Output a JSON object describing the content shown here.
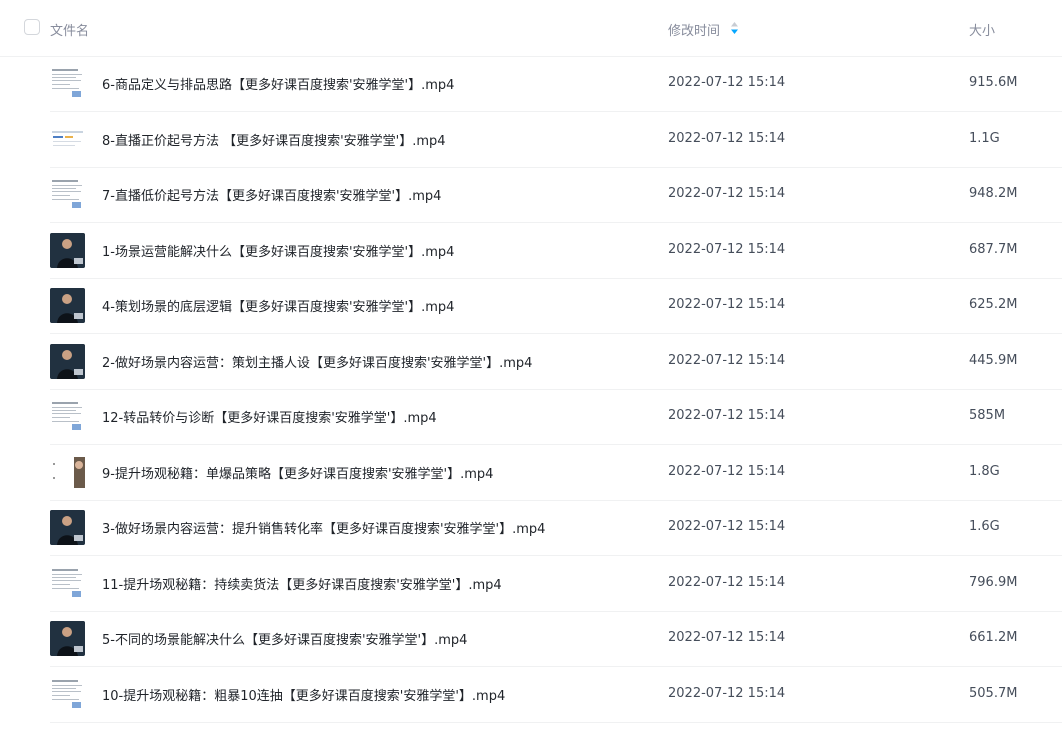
{
  "header": {
    "name_label": "文件名",
    "time_label": "修改时间",
    "size_label": "大小"
  },
  "files": [
    {
      "name": "6-商品定义与排品思路【更多好课百度搜索'安雅学堂'】.mp4",
      "time": "2022-07-12 15:14",
      "size": "915.6M",
      "thumb": "document"
    },
    {
      "name": "8-直播正价起号方法 【更多好课百度搜索'安雅学堂'】.mp4",
      "time": "2022-07-12 15:14",
      "size": "1.1G",
      "thumb": "slide"
    },
    {
      "name": "7-直播低价起号方法【更多好课百度搜索'安雅学堂'】.mp4",
      "time": "2022-07-12 15:14",
      "size": "948.2M",
      "thumb": "document"
    },
    {
      "name": "1-场景运营能解决什么【更多好课百度搜索'安雅学堂'】.mp4",
      "time": "2022-07-12 15:14",
      "size": "687.7M",
      "thumb": "presenter"
    },
    {
      "name": "4-策划场景的底层逻辑【更多好课百度搜索'安雅学堂'】.mp4",
      "time": "2022-07-12 15:14",
      "size": "625.2M",
      "thumb": "presenter"
    },
    {
      "name": "2-做好场景内容运营：策划主播人设【更多好课百度搜索'安雅学堂'】.mp4",
      "time": "2022-07-12 15:14",
      "size": "445.9M",
      "thumb": "presenter"
    },
    {
      "name": "12-转品转价与诊断【更多好课百度搜索'安雅学堂'】.mp4",
      "time": "2022-07-12 15:14",
      "size": "585M",
      "thumb": "document"
    },
    {
      "name": "9-提升场观秘籍：单爆品策略【更多好课百度搜索'安雅学堂'】.mp4",
      "time": "2022-07-12 15:14",
      "size": "1.8G",
      "thumb": "photo"
    },
    {
      "name": "3-做好场景内容运营：提升销售转化率【更多好课百度搜索'安雅学堂'】.mp4",
      "time": "2022-07-12 15:14",
      "size": "1.6G",
      "thumb": "presenter"
    },
    {
      "name": "11-提升场观秘籍：持续卖货法【更多好课百度搜索'安雅学堂'】.mp4",
      "time": "2022-07-12 15:14",
      "size": "796.9M",
      "thumb": "document"
    },
    {
      "name": "5-不同的场景能解决什么【更多好课百度搜索'安雅学堂'】.mp4",
      "time": "2022-07-12 15:14",
      "size": "661.2M",
      "thumb": "presenter"
    },
    {
      "name": "10-提升场观秘籍：粗暴10连抽【更多好课百度搜索'安雅学堂'】.mp4",
      "time": "2022-07-12 15:14",
      "size": "505.7M",
      "thumb": "document"
    }
  ],
  "colors": {
    "sort_accent": "#06a7ff",
    "divider": "#f0f1f2",
    "header_text": "#878c9c"
  }
}
